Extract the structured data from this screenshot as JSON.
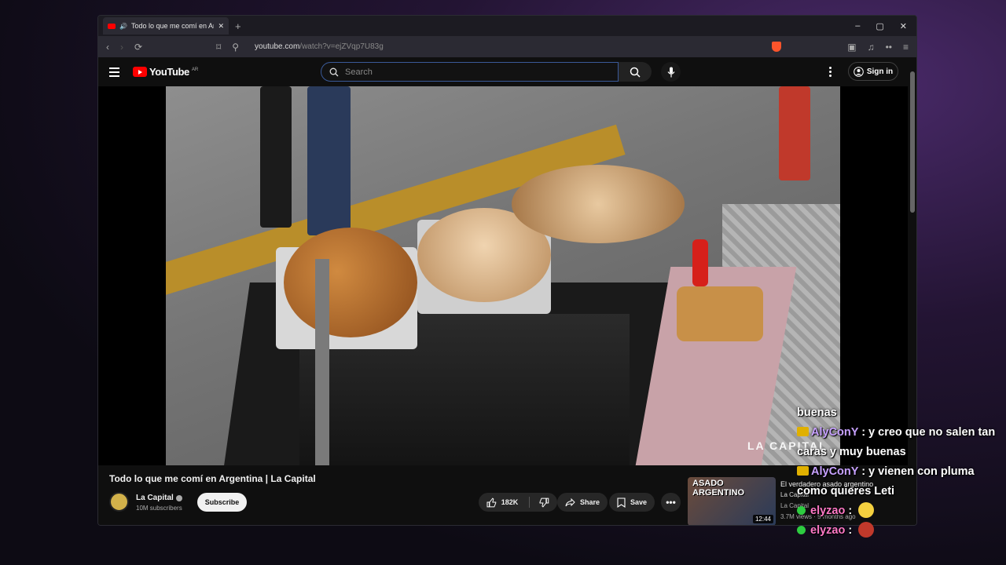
{
  "browser": {
    "tab_title": "Todo lo que me comí en Arge",
    "new_tab": "+",
    "url_host": "youtube.com",
    "url_path": "/watch?v=ejZVqp7U83g",
    "minimize": "–",
    "maximize": "▢",
    "close": "✕"
  },
  "youtube": {
    "logo_text": "YouTube",
    "country_code": "AR",
    "search_placeholder": "Search",
    "sign_in": "Sign in"
  },
  "video": {
    "watermark": "LA CAPITAL",
    "title": "Todo lo que me comí en Argentina | La Capital",
    "channel": "La Capital",
    "subscribers": "10M subscribers",
    "subscribe": "Subscribe",
    "likes": "182K",
    "share": "Share",
    "save": "Save"
  },
  "recommendation": {
    "thumb_title": "ASADO ARGENTINO",
    "duration": "12:44",
    "title": "El verdadero asado argentino",
    "channel": "La Capital",
    "channel_line2": "La Capital",
    "meta": "3.7M views · 5 months ago"
  },
  "chat": [
    {
      "user": "",
      "text": "buenas",
      "badge": "none"
    },
    {
      "user": "AlyConY",
      "text": " : y creo que no salen tan caras y muy buenas",
      "badge": "crown"
    },
    {
      "user": "AlyConY",
      "text": " : y vienen con pluma como quieres Leti",
      "badge": "crown"
    },
    {
      "user": "elyzao",
      "text": " : ",
      "badge": "dot",
      "emote_color": "#f4d03f"
    },
    {
      "user": "elyzao",
      "text": " : ",
      "badge": "dot",
      "emote_color": "#c0392b"
    }
  ],
  "colors": {
    "yt_red": "#ff0000",
    "chat_user": "#c7a1ff",
    "chat_user_alt": "#ff79c6"
  }
}
